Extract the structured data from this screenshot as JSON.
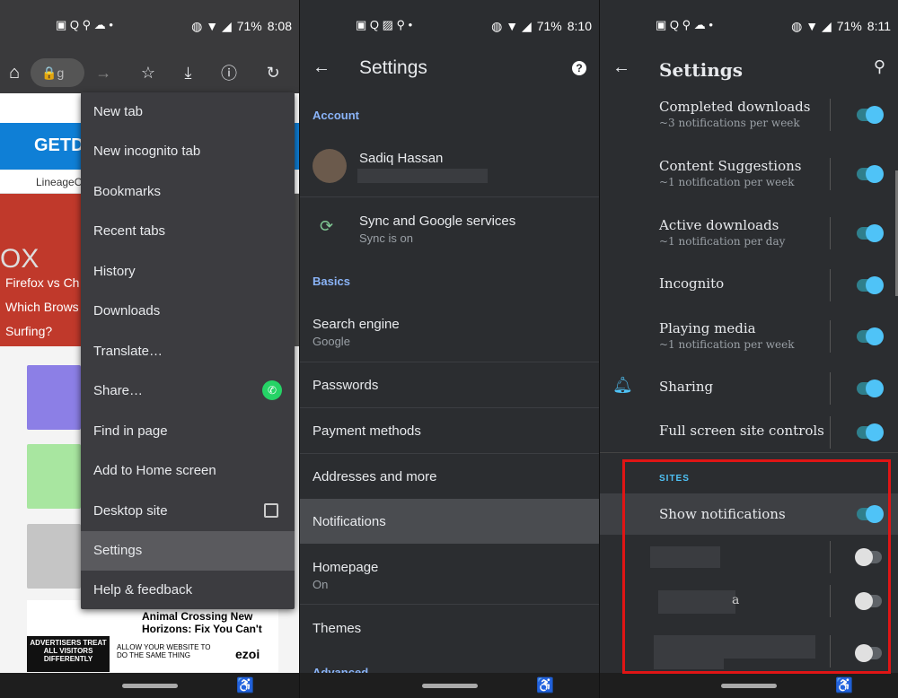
{
  "panel1": {
    "status": {
      "battery": "71%",
      "time": "8:08"
    },
    "url_fragment": "g",
    "site_text": {
      "banner": "GETDI",
      "tab_text": "LineageO",
      "hero_line1": "Firefox vs Ch",
      "hero_line2": "Which Brows",
      "hero_line3": "Surfing?",
      "hero_ox": "OX",
      "ad_title": "Animal Crossing New Horizons: Fix You Can't",
      "ad_left": "ADVERTISERS TREAT ALL VISITORS DIFFERENTLY",
      "ad_mid": "ALLOW YOUR WEBSITE TO DO THE SAME THING",
      "ad_brand": "ezoi"
    },
    "menu": {
      "items": [
        "New tab",
        "New incognito tab",
        "Bookmarks",
        "Recent tabs",
        "History",
        "Downloads",
        "Translate…",
        "Share…",
        "Find in page",
        "Add to Home screen",
        "Desktop site",
        "Settings",
        "Help & feedback"
      ],
      "selected": "Settings"
    }
  },
  "panel2": {
    "status": {
      "battery": "71%",
      "time": "8:10"
    },
    "title": "Settings",
    "sections": {
      "account": "Account",
      "basics": "Basics",
      "advanced": "Advanced"
    },
    "account_name": "Sadiq Hassan",
    "sync": {
      "title": "Sync and Google services",
      "subtitle": "Sync is on"
    },
    "search": {
      "title": "Search engine",
      "subtitle": "Google"
    },
    "passwords": "Passwords",
    "payment": "Payment methods",
    "addresses": "Addresses and more",
    "notifications": "Notifications",
    "homepage": {
      "title": "Homepage",
      "subtitle": "On"
    },
    "themes": "Themes"
  },
  "panel3": {
    "status": {
      "battery": "71%",
      "time": "8:11"
    },
    "title": "Settings",
    "rows": [
      {
        "name": "Completed downloads",
        "desc": "~3 notifications per week",
        "on": true
      },
      {
        "name": "Content Suggestions",
        "desc": "~1 notification per week",
        "on": true
      },
      {
        "name": "Active downloads",
        "desc": "~1 notification per day",
        "on": true
      },
      {
        "name": "Incognito",
        "desc": "",
        "on": true
      },
      {
        "name": "Playing media",
        "desc": "~1 notification per week",
        "on": true
      },
      {
        "name": "Sharing",
        "desc": "",
        "on": true
      },
      {
        "name": "Full screen site controls",
        "desc": "",
        "on": true
      }
    ],
    "sites_header": "SITES",
    "show_notifications": "Show notifications",
    "site_fragment": "a"
  },
  "colors": {
    "accent": "#8ab4f8",
    "toggle_on": "#4fc3f7",
    "highlight_box": "#e01515",
    "whatsapp": "#25d366"
  }
}
